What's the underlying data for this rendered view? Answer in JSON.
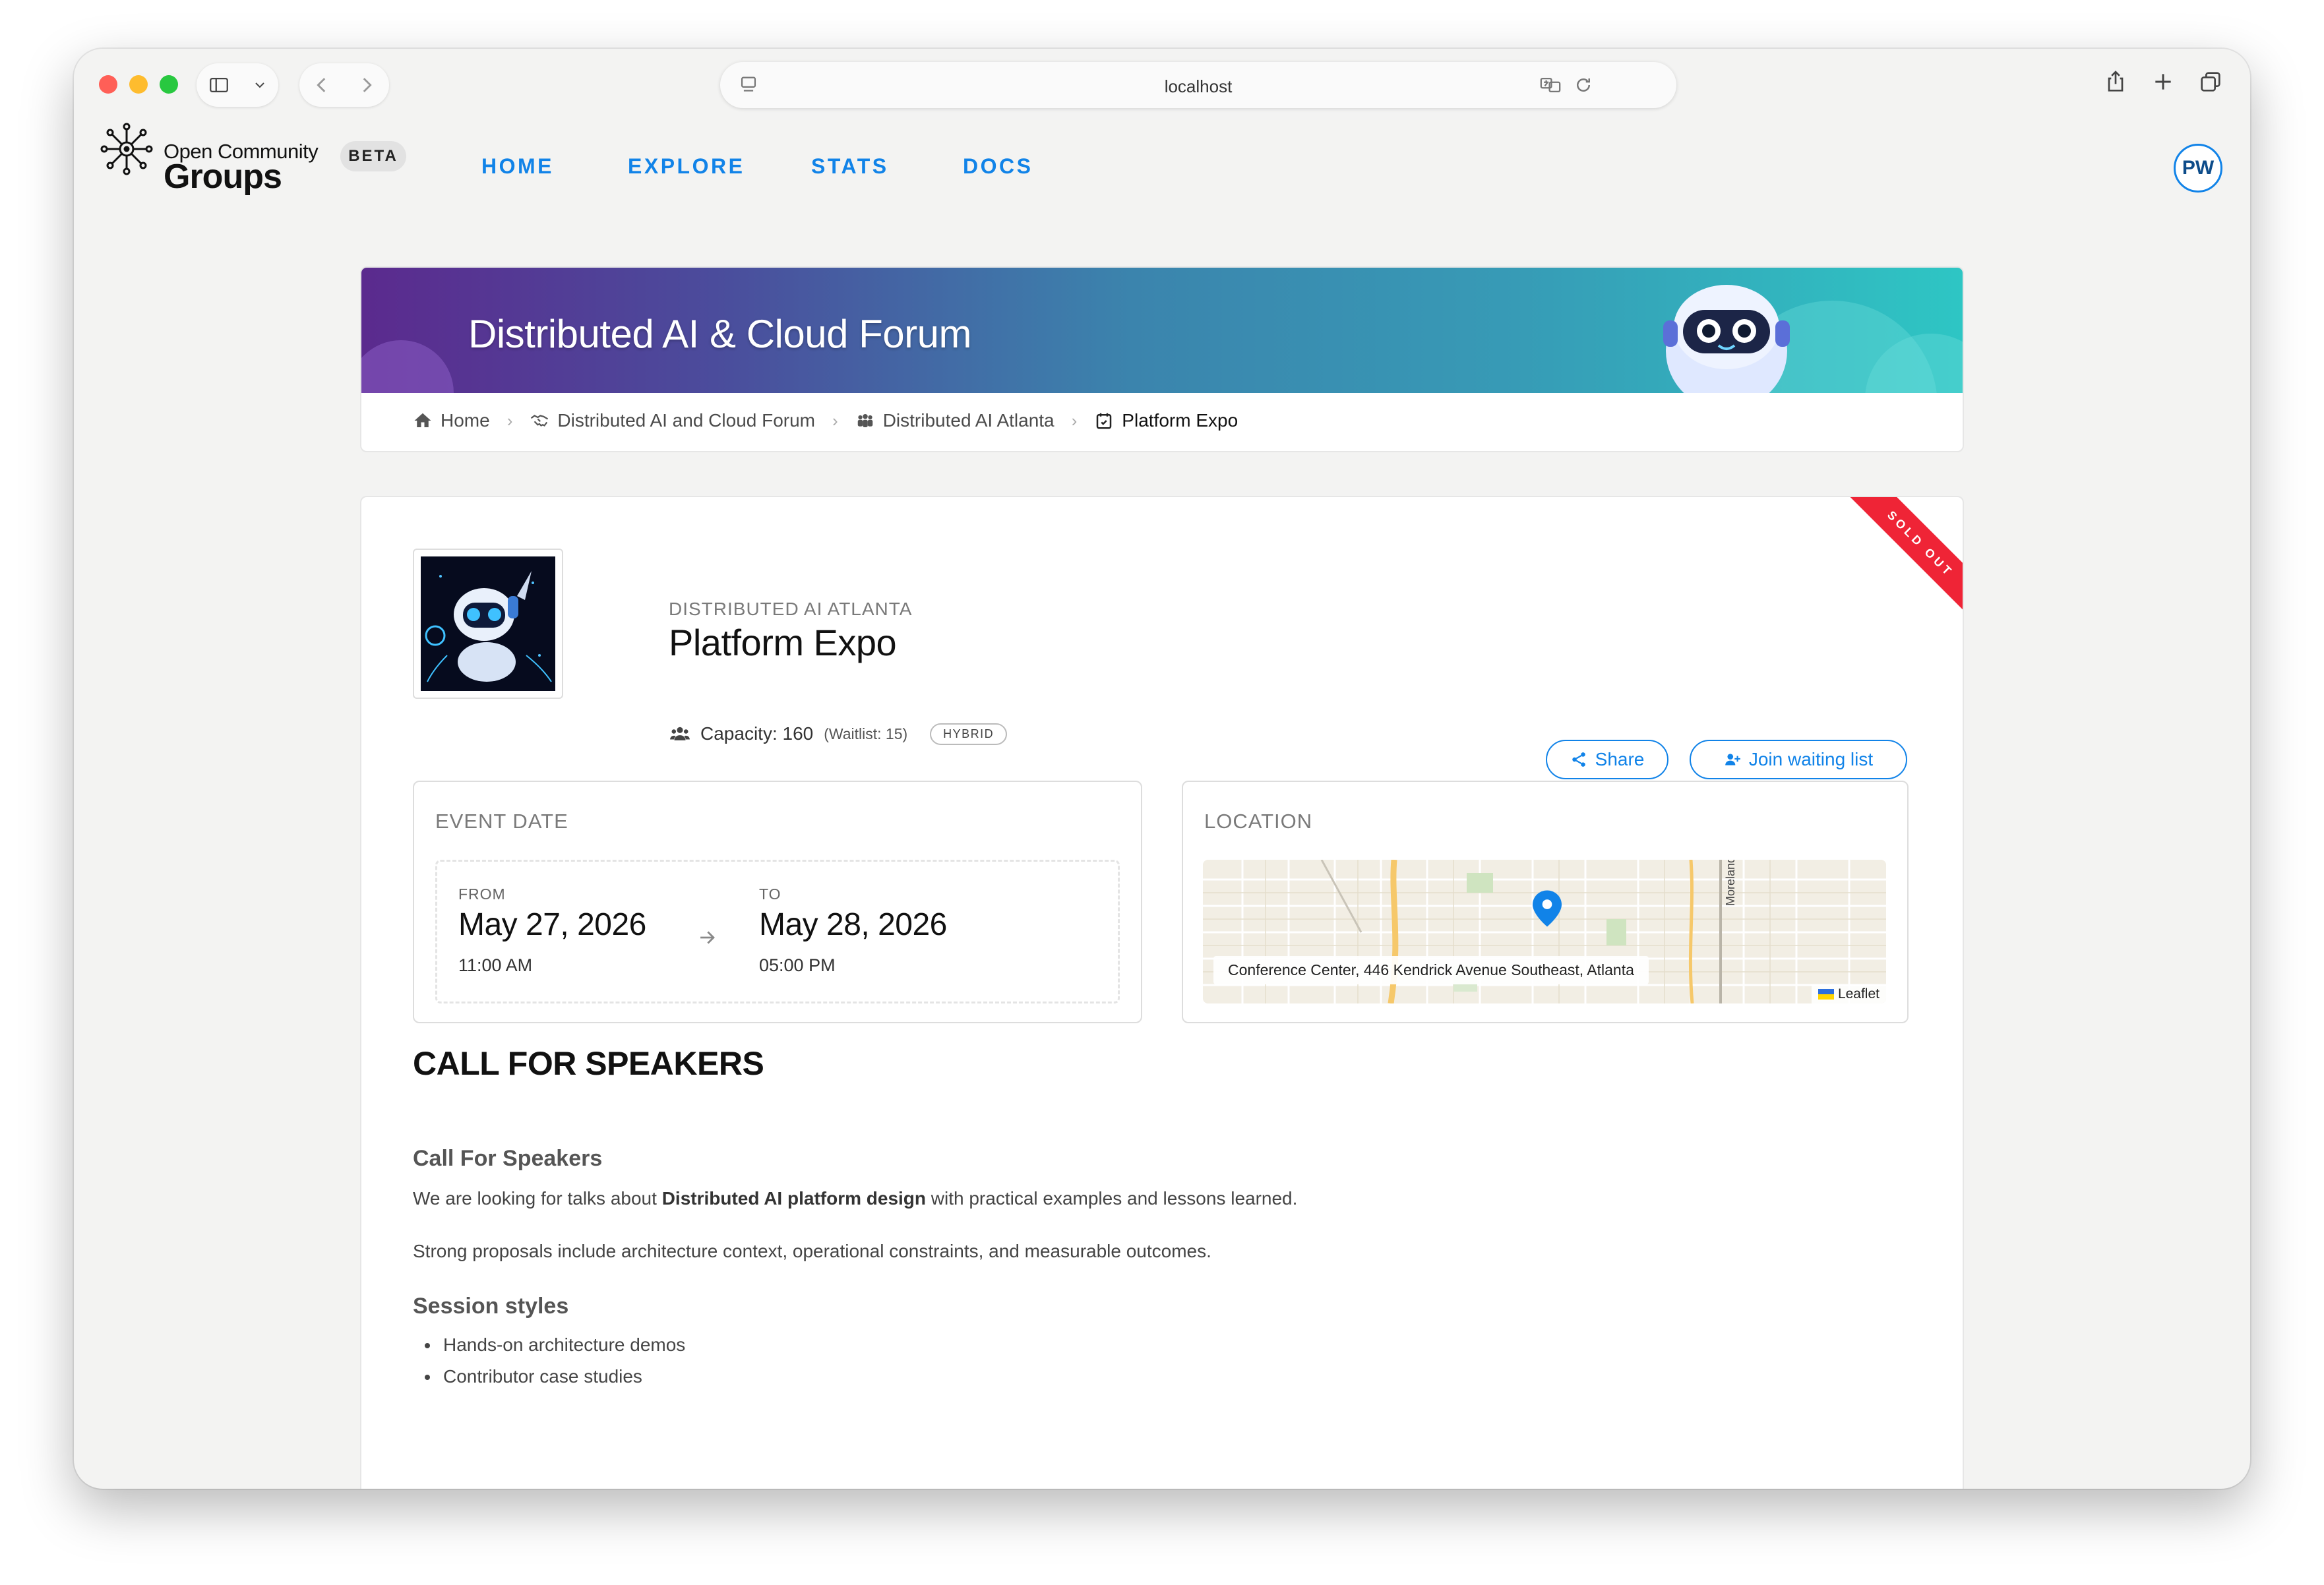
{
  "browser": {
    "url": "localhost"
  },
  "nav": {
    "brand_small": "Open Community",
    "brand_big": "Groups",
    "beta": "BETA",
    "links": [
      "HOME",
      "EXPLORE",
      "STATS",
      "DOCS"
    ],
    "avatar_initials": "PW"
  },
  "banner": {
    "title": "Distributed AI & Cloud Forum"
  },
  "breadcrumb": {
    "items": [
      "Home",
      "Distributed AI and Cloud Forum",
      "Distributed AI Atlanta",
      "Platform Expo"
    ]
  },
  "event": {
    "status_ribbon": "SOLD OUT",
    "group": "DISTRIBUTED AI ATLANTA",
    "title": "Platform Expo",
    "capacity": "Capacity: 160",
    "waitlist": "(Waitlist: 15)",
    "kind": "HYBRID",
    "share_label": "Share",
    "join_label": "Join waiting list"
  },
  "event_date": {
    "heading": "EVENT DATE",
    "from_label": "FROM",
    "from_date": "May 27, 2026",
    "from_time": "11:00 AM",
    "to_label": "TO",
    "to_date": "May 28, 2026",
    "to_time": "05:00 PM"
  },
  "location": {
    "heading": "LOCATION",
    "address": "Conference Center, 446 Kendrick Avenue Southeast, Atlanta",
    "street_label": "Moreland Avenue",
    "attribution": "Leaflet"
  },
  "content": {
    "section_title": "CALL FOR SPEAKERS",
    "subtitle1": "Call For Speakers",
    "para1_pre": "We are looking for talks about ",
    "para1_bold": "Distributed AI platform design",
    "para1_post": " with practical examples and lessons learned.",
    "para2": "Strong proposals include architecture context, operational constraints, and measurable outcomes.",
    "subtitle2": "Session styles",
    "bullets": [
      "Hands-on architecture demos",
      "Contributor case studies"
    ]
  },
  "colors": {
    "accent": "#1183e8",
    "ribbon": "#ef2436"
  }
}
